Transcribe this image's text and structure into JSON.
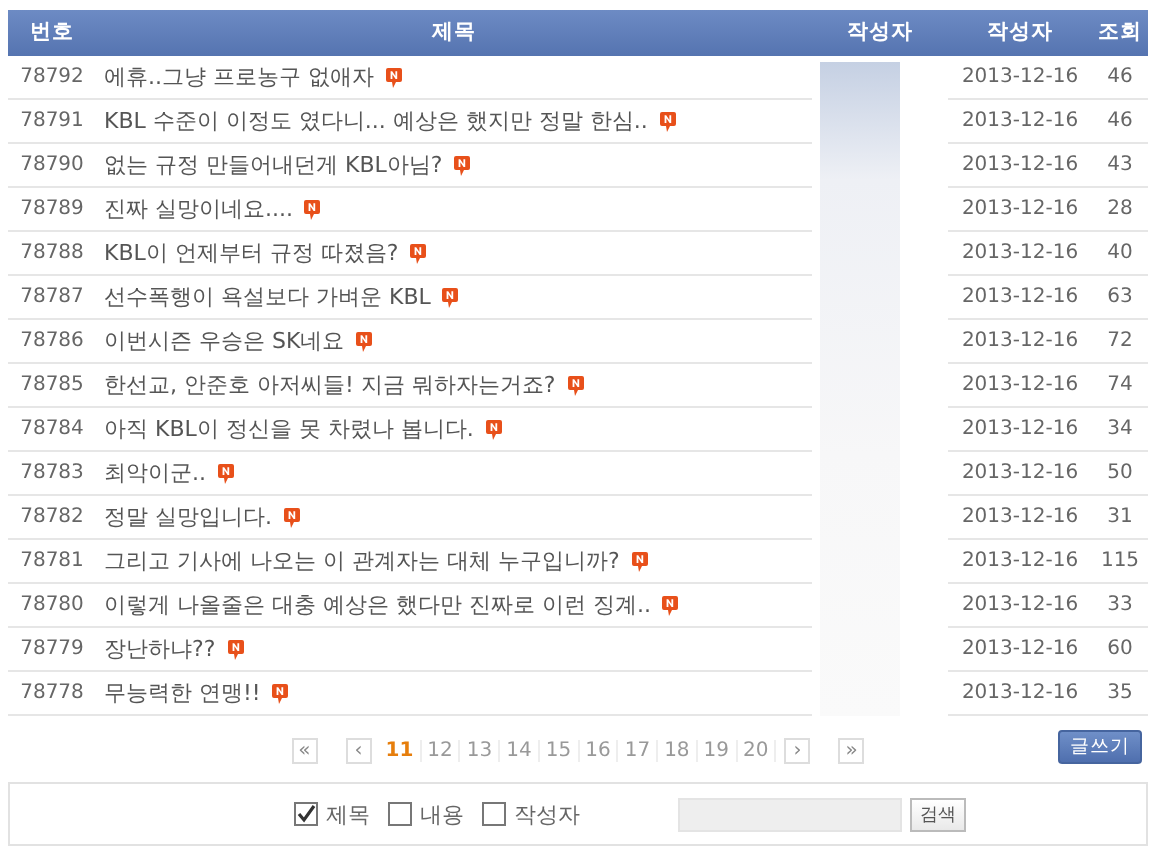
{
  "table": {
    "columns": [
      "번호",
      "제목",
      "작성자",
      "작성자",
      "조회"
    ],
    "rows": [
      {
        "number": "78792",
        "title": "에휴..그냥 프로농구 없애자",
        "new": true,
        "date": "2013-12-16",
        "views": "46"
      },
      {
        "number": "78791",
        "title": "KBL 수준이 이정도 였다니... 예상은 했지만 정말 한심..",
        "new": true,
        "date": "2013-12-16",
        "views": "46"
      },
      {
        "number": "78790",
        "title": "없는 규정 만들어내던게 KBL아님?",
        "new": true,
        "date": "2013-12-16",
        "views": "43"
      },
      {
        "number": "78789",
        "title": "진짜 실망이네요....",
        "new": true,
        "date": "2013-12-16",
        "views": "28"
      },
      {
        "number": "78788",
        "title": "KBL이 언제부터 규정 따졌음?",
        "new": true,
        "date": "2013-12-16",
        "views": "40"
      },
      {
        "number": "78787",
        "title": "선수폭행이 욕설보다 가벼운 KBL",
        "new": true,
        "date": "2013-12-16",
        "views": "63"
      },
      {
        "number": "78786",
        "title": "이번시즌 우승은 SK네요",
        "new": true,
        "date": "2013-12-16",
        "views": "72"
      },
      {
        "number": "78785",
        "title": "한선교, 안준호 아저씨들! 지금 뭐하자는거죠?",
        "new": true,
        "date": "2013-12-16",
        "views": "74"
      },
      {
        "number": "78784",
        "title": "아직 KBL이 정신을 못 차렸나 봅니다.",
        "new": true,
        "date": "2013-12-16",
        "views": "34"
      },
      {
        "number": "78783",
        "title": "최악이군..",
        "new": true,
        "date": "2013-12-16",
        "views": "50"
      },
      {
        "number": "78782",
        "title": "정말 실망입니다.",
        "new": true,
        "date": "2013-12-16",
        "views": "31"
      },
      {
        "number": "78781",
        "title": "그리고 기사에 나오는 이 관계자는 대체 누구입니까?",
        "new": true,
        "date": "2013-12-16",
        "views": "115"
      },
      {
        "number": "78780",
        "title": "이렇게 나올줄은 대충 예상은 했다만 진짜로 이런 징계..",
        "new": true,
        "date": "2013-12-16",
        "views": "33"
      },
      {
        "number": "78779",
        "title": "장난하냐??",
        "new": true,
        "date": "2013-12-16",
        "views": "60"
      },
      {
        "number": "78778",
        "title": "무능력한 연맹!!",
        "new": true,
        "date": "2013-12-16",
        "views": "35"
      }
    ]
  },
  "pagination": {
    "first": "«",
    "prev": "‹",
    "next": "›",
    "last": "»",
    "pages": [
      {
        "label": "11",
        "selected": true
      },
      {
        "label": "12",
        "selected": false
      },
      {
        "label": "13",
        "selected": false
      },
      {
        "label": "14",
        "selected": false
      },
      {
        "label": "15",
        "selected": false
      },
      {
        "label": "16",
        "selected": false
      },
      {
        "label": "17",
        "selected": false
      },
      {
        "label": "18",
        "selected": false
      },
      {
        "label": "19",
        "selected": false
      },
      {
        "label": "20",
        "selected": false
      }
    ]
  },
  "write_button": "글쓰기",
  "search": {
    "options": [
      {
        "label": "제목",
        "checked": true
      },
      {
        "label": "내용",
        "checked": false
      },
      {
        "label": "작성자",
        "checked": false
      }
    ],
    "button": "검색"
  }
}
